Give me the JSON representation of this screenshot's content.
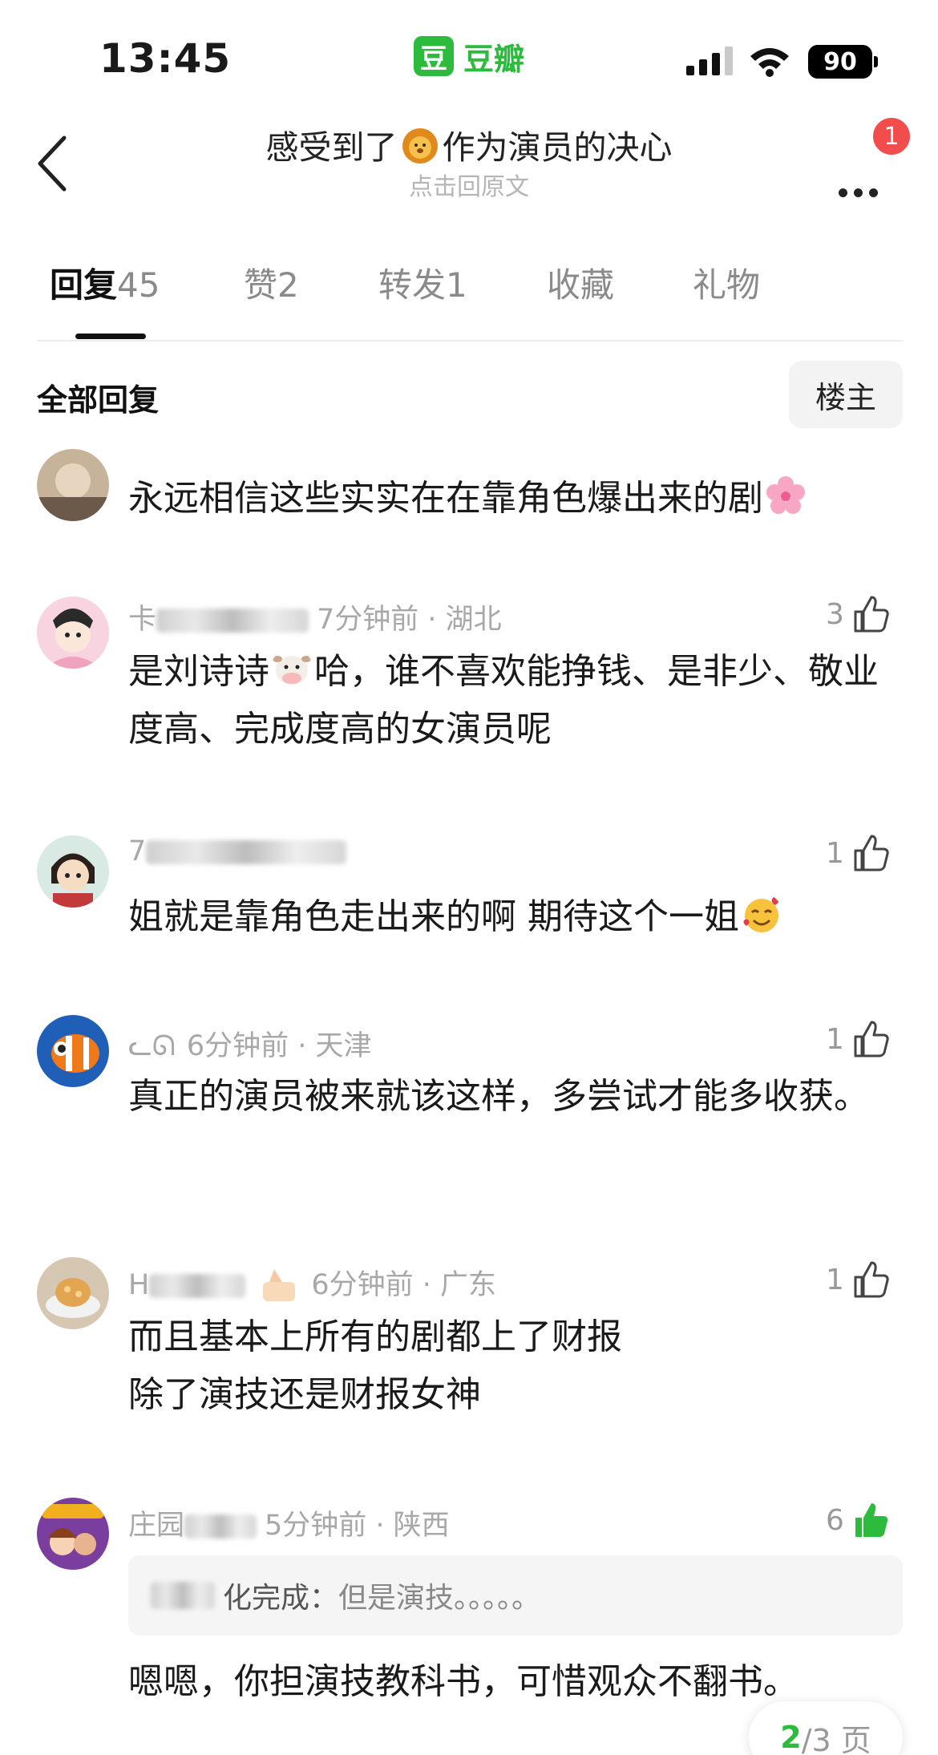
{
  "status_bar": {
    "time": "13:45",
    "app_name": "豆瓣",
    "app_logo_char": "豆",
    "battery": "90"
  },
  "header": {
    "title_prefix": "感受到了",
    "title_emoji": "lion-emoji",
    "title_suffix": "作为演员的决心",
    "subtitle": "点击回原文",
    "notification_count": "1"
  },
  "tabs": [
    {
      "label": "回复",
      "count": "45",
      "active": true
    },
    {
      "label": "赞",
      "count": "2"
    },
    {
      "label": "转发",
      "count": "1"
    },
    {
      "label": "收藏",
      "count": ""
    },
    {
      "label": "礼物",
      "count": ""
    }
  ],
  "filter": {
    "label": "全部回复",
    "op_button": "楼主"
  },
  "comments": [
    {
      "text": "永远相信这些实实在在靠角色爆出来的剧",
      "emoji": "cherry-blossom-emoji"
    },
    {
      "name_partial": "卡",
      "meta": "7分钟前 · 湖北",
      "likes": "3",
      "text_before_emoji": "是刘诗诗",
      "emoji": "cow-emoji",
      "text_after_emoji": "哈，谁不喜欢能挣钱、是非少、敬业度高、完成度高的女演员呢"
    },
    {
      "name_partial": "7",
      "meta": "",
      "likes": "1",
      "text": "姐就是靠角色走出来的啊 期待这个一姐",
      "emoji": "smiling-face-with-hearts-emoji"
    },
    {
      "name_partial": "ᓚᘏ",
      "meta": "6分钟前 · 天津",
      "likes": "1",
      "text": "真正的演员被来就该这样，多尝试才能多收获。"
    },
    {
      "name_partial": "H",
      "meta": "6分钟前 · 广东",
      "likes": "1",
      "text_line1": "而且基本上所有的剧都上了财报",
      "text_line2": "除了演技还是财报女神"
    },
    {
      "name_partial": "庄园",
      "meta": "5分钟前 · 陕西",
      "likes": "6",
      "quote_author": "化完成：",
      "quote_text": "但是演技。。。。。",
      "text": "嗯嗯，你担演技教科书，可惜观众不翻书。"
    }
  ],
  "pager": {
    "current": "2",
    "total": "/3 页"
  },
  "colors": {
    "accent": "#2dbb3d",
    "badge": "#f24d4d",
    "muted": "#a8a8a8"
  }
}
